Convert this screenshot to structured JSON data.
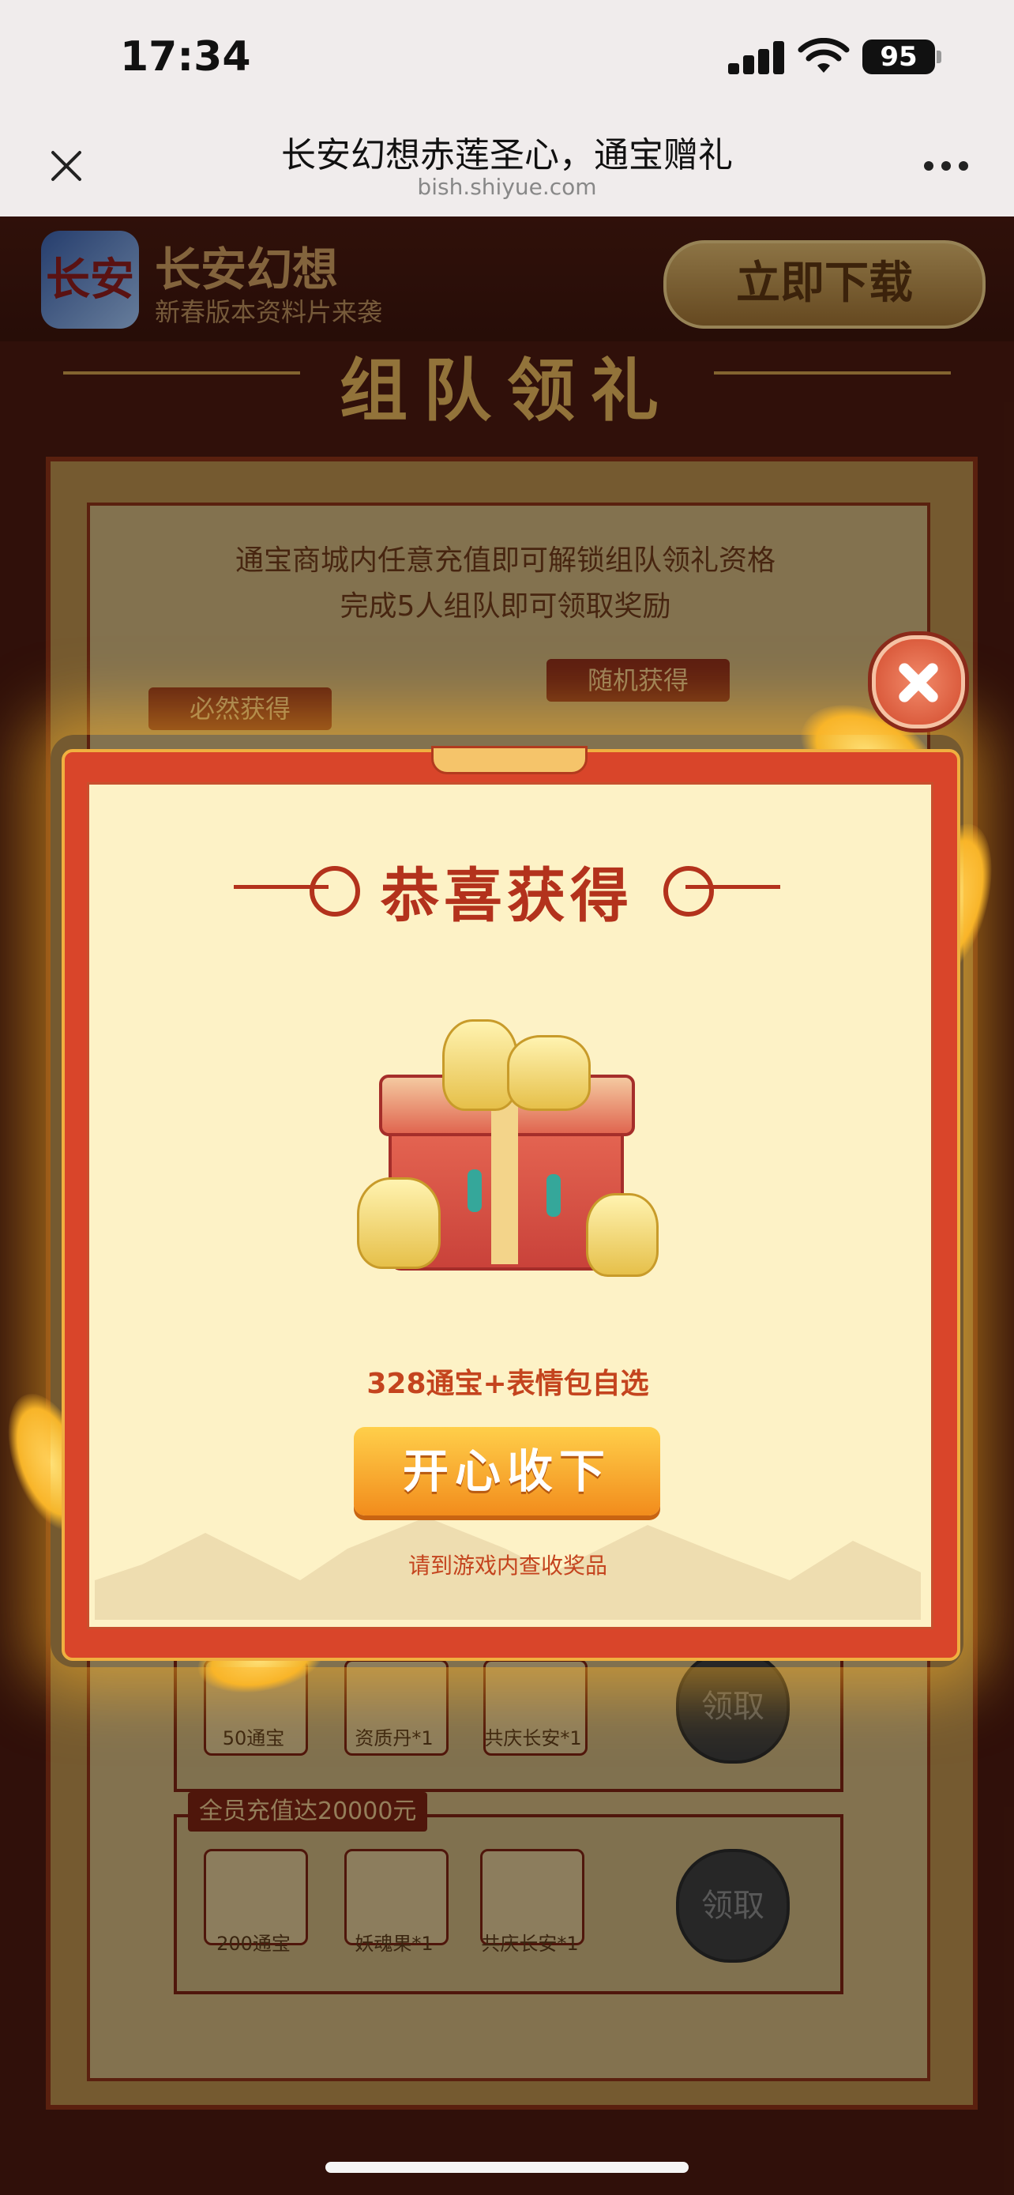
{
  "status_bar": {
    "time": "17:34",
    "battery": "95"
  },
  "browser": {
    "title": "长安幻想赤莲圣心，通宝赠礼",
    "url": "bish.shiyue.com"
  },
  "app_header": {
    "logo_text": "长安",
    "name": "长安幻想",
    "subtitle": "新春版本资料片来袭",
    "download_label": "立即下载"
  },
  "background_page": {
    "heading": "组队领礼",
    "notice_line1": "通宝商城内任意充值即可解锁组队领礼资格",
    "notice_line2": "完成5人组队即可领取奖励",
    "tag_required": "必然获得",
    "tag_random": "随机获得",
    "rows": [
      {
        "tier_label": "",
        "items": [
          "50通宝",
          "资质丹*1",
          "共庆长安*1"
        ],
        "claim_label": "领取"
      },
      {
        "tier_label": "全员充值达20000元",
        "items": [
          "200通宝",
          "妖魂果*1",
          "共庆长安*1"
        ],
        "claim_label": "领取"
      }
    ]
  },
  "modal": {
    "title": "恭喜获得",
    "reward_text": "328通宝+表情包自选",
    "accept_label": "开心收下",
    "hint": "请到游戏内查收奖品"
  },
  "colors": {
    "modal_frame": "#d9452a",
    "modal_inner": "#fdf2c6",
    "title_red": "#b3321c",
    "accept_gradient_top": "#ffcf4a",
    "accept_gradient_bottom": "#f28c1c"
  },
  "icons": [
    "close-icon",
    "more-icon",
    "signal-icon",
    "wifi-icon",
    "battery-icon",
    "modal-close-icon",
    "gift-box-icon"
  ]
}
